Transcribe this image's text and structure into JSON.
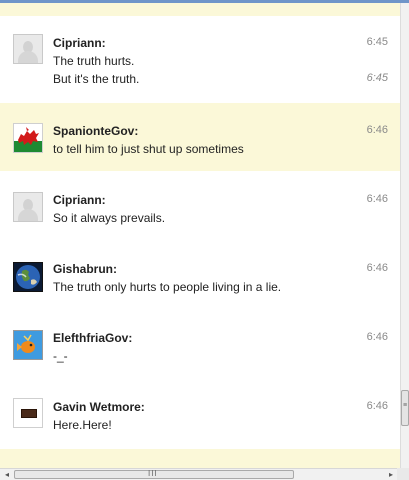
{
  "messages": [
    {
      "avatar": "default-user-avatar-icon",
      "name": "Cipriann:",
      "lines": [
        {
          "text": "The truth hurts.",
          "time": "6:45",
          "italic": false
        },
        {
          "text": "But it's the truth.",
          "time": "6:45",
          "italic": true
        }
      ],
      "highlighted": false
    },
    {
      "avatar": "welsh-dragon-flag-avatar-icon",
      "name": "SpanionteGov:",
      "lines": [
        {
          "text": "to tell him to just shut up sometimes",
          "time": "6:46",
          "italic": false
        }
      ],
      "highlighted": true
    },
    {
      "avatar": "default-user-avatar-icon",
      "name": "Cipriann:",
      "lines": [
        {
          "text": "So it always prevails.",
          "time": "6:46",
          "italic": false
        }
      ],
      "highlighted": false
    },
    {
      "avatar": "earth-globe-avatar-icon",
      "name": "Gishabrun:",
      "lines": [
        {
          "text": "The truth only hurts to people living in a lie.",
          "time": "6:46",
          "italic": false
        }
      ],
      "highlighted": false
    },
    {
      "avatar": "orange-fish-avatar-icon",
      "name": "ElefthfriaGov:",
      "lines": [
        {
          "text": "-_-",
          "time": "6:46",
          "italic": false
        }
      ],
      "highlighted": false
    },
    {
      "avatar": "brown-box-avatar-icon",
      "name": "Gavin Wetmore:",
      "lines": [
        {
          "text": "Here.Here!",
          "time": "6:46",
          "italic": false
        }
      ],
      "highlighted": false
    }
  ],
  "scrollbars": {
    "left_arrow": "◂",
    "right_arrow": "▸",
    "h_grip": "III",
    "v_grip": "≡"
  }
}
